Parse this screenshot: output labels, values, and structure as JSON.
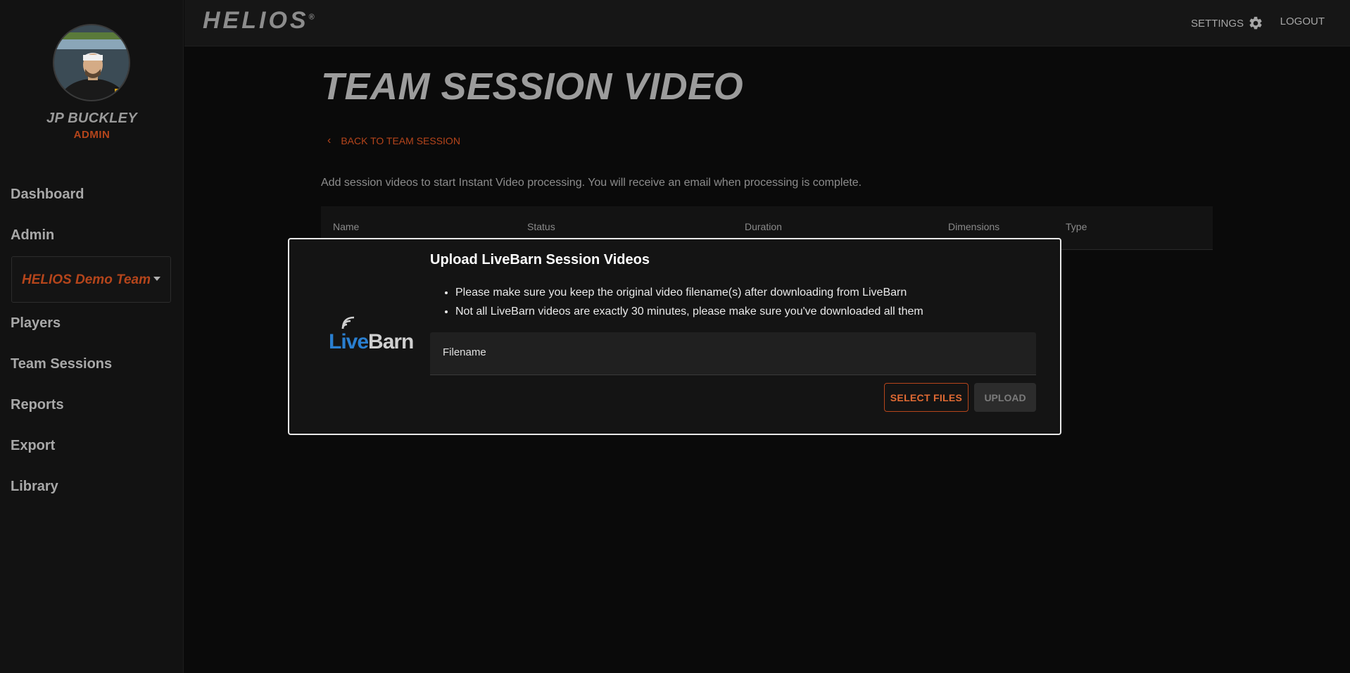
{
  "sidebar": {
    "user_name": "JP BUCKLEY",
    "user_role": "ADMIN",
    "team_select": "HELIOS Demo Team",
    "items": [
      {
        "label": "Dashboard"
      },
      {
        "label": "Admin"
      },
      {
        "label": "Players"
      },
      {
        "label": "Team Sessions"
      },
      {
        "label": "Reports"
      },
      {
        "label": "Export"
      },
      {
        "label": "Library"
      }
    ]
  },
  "topbar": {
    "logo": "HELIOS",
    "logo_mark": "®",
    "settings": "SETTINGS",
    "logout": "LOGOUT",
    "settings_icon": "gear-icon"
  },
  "main": {
    "title": "TEAM SESSION VIDEO",
    "back_link": "BACK TO TEAM SESSION",
    "intro": "Add session videos to start Instant Video processing. You will receive an email when processing is complete.",
    "table_columns": [
      "Name",
      "Status",
      "Duration",
      "Dimensions",
      "Type"
    ]
  },
  "modal": {
    "logo_live": "Live",
    "logo_barn": "Barn",
    "title": "Upload LiveBarn Session Videos",
    "bullets": [
      "Please make sure you keep the original video filename(s) after downloading from LiveBarn",
      "Not all LiveBarn videos are exactly 30 minutes, please make sure you've downloaded all them"
    ],
    "filename_label": "Filename",
    "select_button": "SELECT FILES",
    "upload_button": "UPLOAD"
  },
  "colors": {
    "accent": "#b5451b",
    "livebarn_blue": "#2a7fd0"
  }
}
